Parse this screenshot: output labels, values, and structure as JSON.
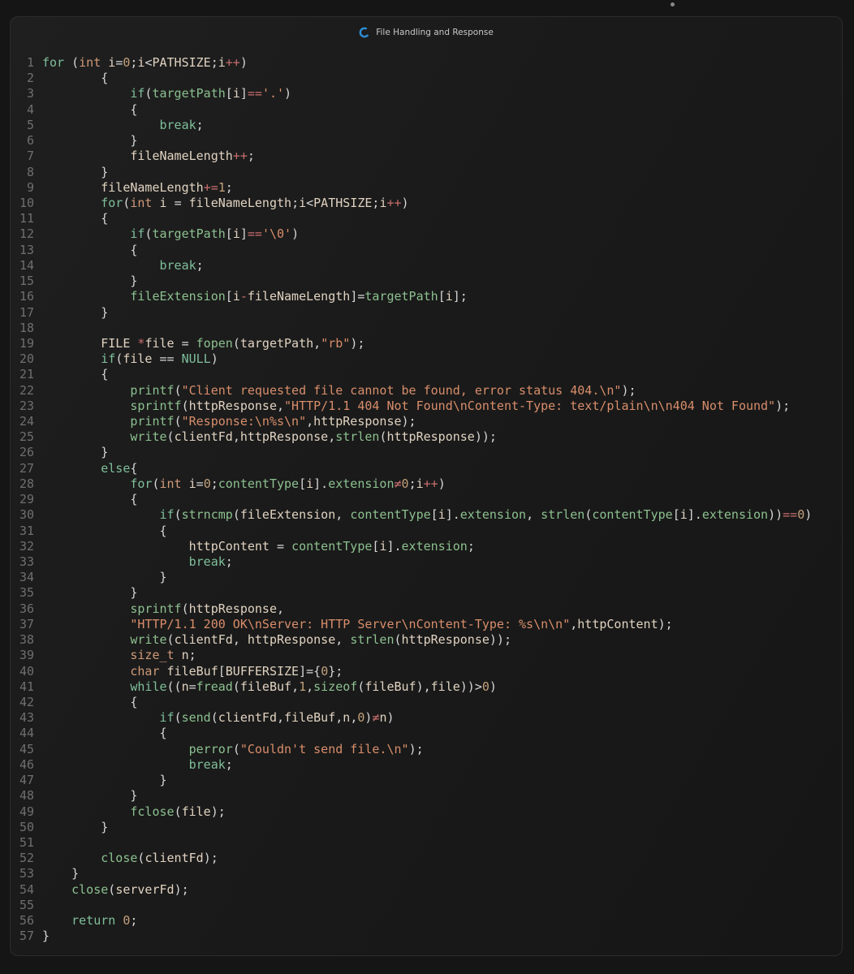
{
  "window": {
    "title": "File Handling and Response",
    "logo_icon": "c-language-icon",
    "accent": "#2d8fd5"
  },
  "code_lines": [
    {
      "n": "1",
      "tokens": [
        [
          "kw",
          "for "
        ],
        [
          "p",
          "("
        ],
        [
          "ty",
          "int "
        ],
        [
          "var",
          "i"
        ],
        [
          "p",
          "="
        ],
        [
          "num",
          "0"
        ],
        [
          "p",
          ";"
        ],
        [
          "var",
          "i"
        ],
        [
          "p",
          "<"
        ],
        [
          "var",
          "PATHSIZE"
        ],
        [
          "p",
          ";"
        ],
        [
          "var",
          "i"
        ],
        [
          "op",
          "++"
        ],
        [
          "p",
          ")"
        ]
      ]
    },
    {
      "n": "2",
      "tokens": [
        [
          "p",
          "        {"
        ]
      ]
    },
    {
      "n": "3",
      "tokens": [
        [
          "p",
          "            "
        ],
        [
          "kw",
          "if"
        ],
        [
          "p",
          "("
        ],
        [
          "fn",
          "targetPath"
        ],
        [
          "p",
          "["
        ],
        [
          "var",
          "i"
        ],
        [
          "p",
          "]"
        ],
        [
          "op",
          "=="
        ],
        [
          "str",
          "'.'"
        ],
        [
          "p",
          ")"
        ]
      ]
    },
    {
      "n": "4",
      "tokens": [
        [
          "p",
          "            {"
        ]
      ]
    },
    {
      "n": "5",
      "tokens": [
        [
          "p",
          "                "
        ],
        [
          "kw",
          "break"
        ],
        [
          "p",
          ";"
        ]
      ]
    },
    {
      "n": "6",
      "tokens": [
        [
          "p",
          "            }"
        ]
      ]
    },
    {
      "n": "7",
      "tokens": [
        [
          "p",
          "            "
        ],
        [
          "var",
          "fileNameLength"
        ],
        [
          "op",
          "++"
        ],
        [
          "p",
          ";"
        ]
      ]
    },
    {
      "n": "8",
      "tokens": [
        [
          "p",
          "        }"
        ]
      ]
    },
    {
      "n": "9",
      "tokens": [
        [
          "p",
          "        "
        ],
        [
          "var",
          "fileNameLength"
        ],
        [
          "op",
          "+="
        ],
        [
          "num",
          "1"
        ],
        [
          "p",
          ";"
        ]
      ]
    },
    {
      "n": "10",
      "tokens": [
        [
          "p",
          "        "
        ],
        [
          "kw",
          "for"
        ],
        [
          "p",
          "("
        ],
        [
          "ty",
          "int "
        ],
        [
          "var",
          "i "
        ],
        [
          "p",
          "= "
        ],
        [
          "var",
          "fileNameLength"
        ],
        [
          "p",
          ";"
        ],
        [
          "var",
          "i"
        ],
        [
          "p",
          "<"
        ],
        [
          "var",
          "PATHSIZE"
        ],
        [
          "p",
          ";"
        ],
        [
          "var",
          "i"
        ],
        [
          "op",
          "++"
        ],
        [
          "p",
          ")"
        ]
      ]
    },
    {
      "n": "11",
      "tokens": [
        [
          "p",
          "        {"
        ]
      ]
    },
    {
      "n": "12",
      "tokens": [
        [
          "p",
          "            "
        ],
        [
          "kw",
          "if"
        ],
        [
          "p",
          "("
        ],
        [
          "fn",
          "targetPath"
        ],
        [
          "p",
          "["
        ],
        [
          "var",
          "i"
        ],
        [
          "p",
          "]"
        ],
        [
          "op",
          "=="
        ],
        [
          "str",
          "'\\0'"
        ],
        [
          "p",
          ")"
        ]
      ]
    },
    {
      "n": "13",
      "tokens": [
        [
          "p",
          "            {"
        ]
      ]
    },
    {
      "n": "14",
      "tokens": [
        [
          "p",
          "                "
        ],
        [
          "kw",
          "break"
        ],
        [
          "p",
          ";"
        ]
      ]
    },
    {
      "n": "15",
      "tokens": [
        [
          "p",
          "            }"
        ]
      ]
    },
    {
      "n": "16",
      "tokens": [
        [
          "p",
          "            "
        ],
        [
          "fn",
          "fileExtension"
        ],
        [
          "p",
          "["
        ],
        [
          "var",
          "i"
        ],
        [
          "op",
          "-"
        ],
        [
          "var",
          "fileNameLength"
        ],
        [
          "p",
          "]="
        ],
        [
          "fn",
          "targetPath"
        ],
        [
          "p",
          "["
        ],
        [
          "var",
          "i"
        ],
        [
          "p",
          "];"
        ]
      ]
    },
    {
      "n": "17",
      "tokens": [
        [
          "p",
          "        }"
        ]
      ]
    },
    {
      "n": "18",
      "tokens": []
    },
    {
      "n": "19",
      "tokens": [
        [
          "p",
          "        "
        ],
        [
          "var",
          "FILE "
        ],
        [
          "op",
          "*"
        ],
        [
          "var",
          "file "
        ],
        [
          "p",
          "= "
        ],
        [
          "fn",
          "fopen"
        ],
        [
          "p",
          "("
        ],
        [
          "var",
          "targetPath"
        ],
        [
          "p",
          ","
        ],
        [
          "str",
          "\"rb\""
        ],
        [
          "p",
          ");"
        ]
      ]
    },
    {
      "n": "20",
      "tokens": [
        [
          "p",
          "        "
        ],
        [
          "kw",
          "if"
        ],
        [
          "p",
          "("
        ],
        [
          "var",
          "file "
        ],
        [
          "p",
          "== "
        ],
        [
          "kw",
          "NULL"
        ],
        [
          "p",
          ")"
        ]
      ]
    },
    {
      "n": "21",
      "tokens": [
        [
          "p",
          "        {"
        ]
      ]
    },
    {
      "n": "22",
      "tokens": [
        [
          "p",
          "            "
        ],
        [
          "fn",
          "printf"
        ],
        [
          "p",
          "("
        ],
        [
          "str",
          "\"Client requested file cannot be found, error status 404.\\n\""
        ],
        [
          "p",
          ");"
        ]
      ]
    },
    {
      "n": "23",
      "tokens": [
        [
          "p",
          "            "
        ],
        [
          "fn",
          "sprintf"
        ],
        [
          "p",
          "("
        ],
        [
          "var",
          "httpResponse"
        ],
        [
          "p",
          ","
        ],
        [
          "str",
          "\"HTTP/1.1 404 Not Found\\nContent-Type: text/plain\\n\\n404 Not Found\""
        ],
        [
          "p",
          ");"
        ]
      ]
    },
    {
      "n": "24",
      "tokens": [
        [
          "p",
          "            "
        ],
        [
          "fn",
          "printf"
        ],
        [
          "p",
          "("
        ],
        [
          "str",
          "\"Response:\\n%s\\n\""
        ],
        [
          "p",
          ","
        ],
        [
          "var",
          "httpResponse"
        ],
        [
          "p",
          ");"
        ]
      ]
    },
    {
      "n": "25",
      "tokens": [
        [
          "p",
          "            "
        ],
        [
          "fn",
          "write"
        ],
        [
          "p",
          "("
        ],
        [
          "var",
          "clientFd"
        ],
        [
          "p",
          ","
        ],
        [
          "var",
          "httpResponse"
        ],
        [
          "p",
          ","
        ],
        [
          "fn",
          "strlen"
        ],
        [
          "p",
          "("
        ],
        [
          "var",
          "httpResponse"
        ],
        [
          "p",
          "));"
        ]
      ]
    },
    {
      "n": "26",
      "tokens": [
        [
          "p",
          "        }"
        ]
      ]
    },
    {
      "n": "27",
      "tokens": [
        [
          "p",
          "        "
        ],
        [
          "kw",
          "else"
        ],
        [
          "p",
          "{"
        ]
      ]
    },
    {
      "n": "28",
      "tokens": [
        [
          "p",
          "            "
        ],
        [
          "kw",
          "for"
        ],
        [
          "p",
          "("
        ],
        [
          "ty",
          "int "
        ],
        [
          "var",
          "i"
        ],
        [
          "p",
          "="
        ],
        [
          "num",
          "0"
        ],
        [
          "p",
          ";"
        ],
        [
          "fn",
          "contentType"
        ],
        [
          "p",
          "["
        ],
        [
          "var",
          "i"
        ],
        [
          "p",
          "]."
        ],
        [
          "fn",
          "extension"
        ],
        [
          "op",
          "≠"
        ],
        [
          "num",
          "0"
        ],
        [
          "p",
          ";"
        ],
        [
          "var",
          "i"
        ],
        [
          "op",
          "++"
        ],
        [
          "p",
          ")"
        ]
      ]
    },
    {
      "n": "29",
      "tokens": [
        [
          "p",
          "            {"
        ]
      ]
    },
    {
      "n": "30",
      "tokens": [
        [
          "p",
          "                "
        ],
        [
          "kw",
          "if"
        ],
        [
          "p",
          "("
        ],
        [
          "fn",
          "strncmp"
        ],
        [
          "p",
          "("
        ],
        [
          "var",
          "fileExtension"
        ],
        [
          "p",
          ", "
        ],
        [
          "fn",
          "contentType"
        ],
        [
          "p",
          "["
        ],
        [
          "var",
          "i"
        ],
        [
          "p",
          "]."
        ],
        [
          "fn",
          "extension"
        ],
        [
          "p",
          ", "
        ],
        [
          "fn",
          "strlen"
        ],
        [
          "p",
          "("
        ],
        [
          "fn",
          "contentType"
        ],
        [
          "p",
          "["
        ],
        [
          "var",
          "i"
        ],
        [
          "p",
          "]."
        ],
        [
          "fn",
          "extension"
        ],
        [
          "p",
          "))"
        ],
        [
          "op",
          "=="
        ],
        [
          "num",
          "0"
        ],
        [
          "p",
          ")"
        ]
      ]
    },
    {
      "n": "31",
      "tokens": [
        [
          "p",
          "                {"
        ]
      ]
    },
    {
      "n": "32",
      "tokens": [
        [
          "p",
          "                    "
        ],
        [
          "var",
          "httpContent "
        ],
        [
          "p",
          "= "
        ],
        [
          "fn",
          "contentType"
        ],
        [
          "p",
          "["
        ],
        [
          "var",
          "i"
        ],
        [
          "p",
          "]."
        ],
        [
          "fn",
          "extension"
        ],
        [
          "p",
          ";"
        ]
      ]
    },
    {
      "n": "33",
      "tokens": [
        [
          "p",
          "                    "
        ],
        [
          "kw",
          "break"
        ],
        [
          "p",
          ";"
        ]
      ]
    },
    {
      "n": "34",
      "tokens": [
        [
          "p",
          "                }"
        ]
      ]
    },
    {
      "n": "35",
      "tokens": [
        [
          "p",
          "            }"
        ]
      ]
    },
    {
      "n": "36",
      "tokens": [
        [
          "p",
          "            "
        ],
        [
          "fn",
          "sprintf"
        ],
        [
          "p",
          "("
        ],
        [
          "var",
          "httpResponse"
        ],
        [
          "p",
          ","
        ]
      ]
    },
    {
      "n": "37",
      "tokens": [
        [
          "p",
          "            "
        ],
        [
          "str",
          "\"HTTP/1.1 200 OK\\nServer: HTTP Server\\nContent-Type: %s\\n\\n\""
        ],
        [
          "p",
          ","
        ],
        [
          "var",
          "httpContent"
        ],
        [
          "p",
          ");"
        ]
      ]
    },
    {
      "n": "38",
      "tokens": [
        [
          "p",
          "            "
        ],
        [
          "fn",
          "write"
        ],
        [
          "p",
          "("
        ],
        [
          "var",
          "clientFd"
        ],
        [
          "p",
          ", "
        ],
        [
          "var",
          "httpResponse"
        ],
        [
          "p",
          ", "
        ],
        [
          "fn",
          "strlen"
        ],
        [
          "p",
          "("
        ],
        [
          "var",
          "httpResponse"
        ],
        [
          "p",
          "));"
        ]
      ]
    },
    {
      "n": "39",
      "tokens": [
        [
          "p",
          "            "
        ],
        [
          "ty",
          "size_t "
        ],
        [
          "var",
          "n"
        ],
        [
          "p",
          ";"
        ]
      ]
    },
    {
      "n": "40",
      "tokens": [
        [
          "p",
          "            "
        ],
        [
          "ty",
          "char "
        ],
        [
          "var",
          "fileBuf"
        ],
        [
          "p",
          "["
        ],
        [
          "var",
          "BUFFERSIZE"
        ],
        [
          "p",
          "]={"
        ],
        [
          "num",
          "0"
        ],
        [
          "p",
          "};"
        ]
      ]
    },
    {
      "n": "41",
      "tokens": [
        [
          "p",
          "            "
        ],
        [
          "kw",
          "while"
        ],
        [
          "p",
          "(("
        ],
        [
          "var",
          "n"
        ],
        [
          "p",
          "="
        ],
        [
          "fn",
          "fread"
        ],
        [
          "p",
          "("
        ],
        [
          "var",
          "fileBuf"
        ],
        [
          "p",
          ","
        ],
        [
          "num",
          "1"
        ],
        [
          "p",
          ","
        ],
        [
          "fn",
          "sizeof"
        ],
        [
          "p",
          "("
        ],
        [
          "var",
          "fileBuf"
        ],
        [
          "p",
          "),"
        ],
        [
          "var",
          "file"
        ],
        [
          "p",
          "))>"
        ],
        [
          "num",
          "0"
        ],
        [
          "p",
          ")"
        ]
      ]
    },
    {
      "n": "42",
      "tokens": [
        [
          "p",
          "            {"
        ]
      ]
    },
    {
      "n": "43",
      "tokens": [
        [
          "p",
          "                "
        ],
        [
          "kw",
          "if"
        ],
        [
          "p",
          "("
        ],
        [
          "fn",
          "send"
        ],
        [
          "p",
          "("
        ],
        [
          "var",
          "clientFd"
        ],
        [
          "p",
          ","
        ],
        [
          "var",
          "fileBuf"
        ],
        [
          "p",
          ","
        ],
        [
          "var",
          "n"
        ],
        [
          "p",
          ","
        ],
        [
          "num",
          "0"
        ],
        [
          "p",
          ")"
        ],
        [
          "op",
          "≠"
        ],
        [
          "var",
          "n"
        ],
        [
          "p",
          ")"
        ]
      ]
    },
    {
      "n": "44",
      "tokens": [
        [
          "p",
          "                {"
        ]
      ]
    },
    {
      "n": "45",
      "tokens": [
        [
          "p",
          "                    "
        ],
        [
          "fn",
          "perror"
        ],
        [
          "p",
          "("
        ],
        [
          "str",
          "\"Couldn't send file.\\n\""
        ],
        [
          "p",
          ");"
        ]
      ]
    },
    {
      "n": "46",
      "tokens": [
        [
          "p",
          "                    "
        ],
        [
          "kw",
          "break"
        ],
        [
          "p",
          ";"
        ]
      ]
    },
    {
      "n": "47",
      "tokens": [
        [
          "p",
          "                }"
        ]
      ]
    },
    {
      "n": "48",
      "tokens": [
        [
          "p",
          "            }"
        ]
      ]
    },
    {
      "n": "49",
      "tokens": [
        [
          "p",
          "            "
        ],
        [
          "fn",
          "fclose"
        ],
        [
          "p",
          "("
        ],
        [
          "var",
          "file"
        ],
        [
          "p",
          ");"
        ]
      ]
    },
    {
      "n": "50",
      "tokens": [
        [
          "p",
          "        }"
        ]
      ]
    },
    {
      "n": "51",
      "tokens": []
    },
    {
      "n": "52",
      "tokens": [
        [
          "p",
          "        "
        ],
        [
          "fn",
          "close"
        ],
        [
          "p",
          "("
        ],
        [
          "var",
          "clientFd"
        ],
        [
          "p",
          ");"
        ]
      ]
    },
    {
      "n": "53",
      "tokens": [
        [
          "p",
          "    }"
        ]
      ]
    },
    {
      "n": "54",
      "tokens": [
        [
          "p",
          "    "
        ],
        [
          "fn",
          "close"
        ],
        [
          "p",
          "("
        ],
        [
          "var",
          "serverFd"
        ],
        [
          "p",
          ");"
        ]
      ]
    },
    {
      "n": "55",
      "tokens": []
    },
    {
      "n": "56",
      "tokens": [
        [
          "p",
          "    "
        ],
        [
          "kw",
          "return "
        ],
        [
          "num",
          "0"
        ],
        [
          "p",
          ";"
        ]
      ]
    },
    {
      "n": "57",
      "tokens": [
        [
          "p",
          "}"
        ]
      ]
    }
  ]
}
